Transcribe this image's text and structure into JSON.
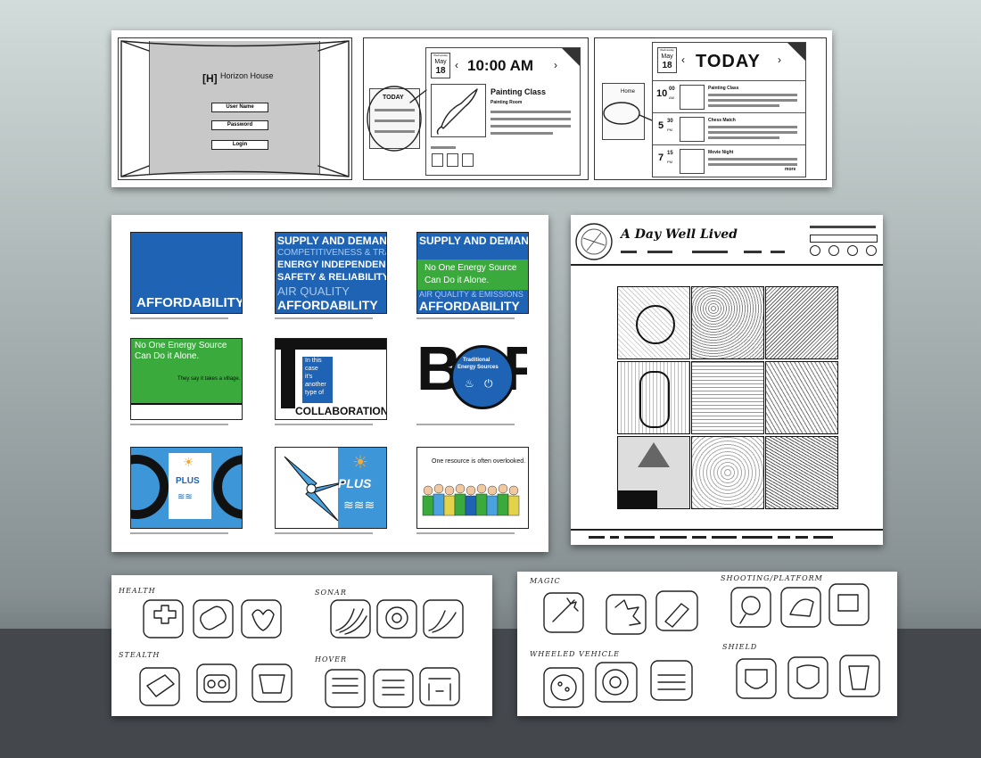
{
  "wireframes": {
    "login": {
      "brand": "Horizon House",
      "username_label": "User Name",
      "password_label": "Password",
      "login_label": "Login"
    },
    "schedule": {
      "day": "Wednesday",
      "month": "May",
      "date": "18",
      "time": "10:00 AM",
      "today": "TODAY",
      "event_title": "Painting Class",
      "event_room": "Painting Room"
    },
    "today": {
      "day": "Wednesday",
      "month": "May",
      "date": "18",
      "title": "TODAY",
      "home_label": "Home",
      "events": [
        {
          "hour": "10",
          "minutes": "00",
          "ampm": "AM",
          "name": "Painting Class"
        },
        {
          "hour": "5",
          "minutes": "30",
          "ampm": "PM",
          "name": "Chess Match"
        },
        {
          "hour": "7",
          "minutes": "15",
          "ampm": "PM",
          "name": "Movie Night"
        }
      ],
      "more_label": "more"
    }
  },
  "storyboard": {
    "frames": [
      {
        "id": "affordability",
        "big": "AFFORDABILITY"
      },
      {
        "id": "supply",
        "lines": [
          "SUPPLY AND DEMAND",
          "COMPETITIVENESS & TRADE",
          "ENERGY INDEPENDENCE",
          "SAFETY & RELIABILITY",
          "AIR QUALITY",
          "AFFORDABILITY"
        ]
      },
      {
        "id": "no-one",
        "lines": [
          "SUPPLY AND DEMAND",
          "No One Energy Source",
          "Can Do it Alone.",
          "AIR QUALITY & EMISSIONS",
          "AFFORDABILITY"
        ]
      },
      {
        "id": "village",
        "lines": [
          "No One Energy Source",
          "Can Do it Alone.",
          "They say it takes a village."
        ]
      },
      {
        "id": "collab",
        "lines": [
          "In this",
          "case",
          "it's",
          "another",
          "type of",
          "COLLABORATION"
        ]
      },
      {
        "id": "traditional",
        "lines": [
          "BOP",
          "Traditional",
          "Energy Sources"
        ]
      },
      {
        "id": "plus-1",
        "lines": [
          "PLUS"
        ]
      },
      {
        "id": "plus-2",
        "lines": [
          "PLUS"
        ]
      },
      {
        "id": "overlooked",
        "lines": [
          "One resource is often overlooked."
        ]
      }
    ]
  },
  "website": {
    "title": "A Day Well Lived"
  },
  "icon_sketches_left": {
    "groups": [
      "HEALTH",
      "SONAR",
      "STEALTH",
      "HOVER"
    ]
  },
  "icon_sketches_right": {
    "groups": [
      "MAGIC",
      "SHOOTING/PLATFORM",
      "WHEELED VEHICLE",
      "SHIELD"
    ]
  },
  "colors": {
    "blue": "#1f63b4",
    "green": "#3aaa3d",
    "black": "#111111",
    "white": "#ffffff"
  }
}
